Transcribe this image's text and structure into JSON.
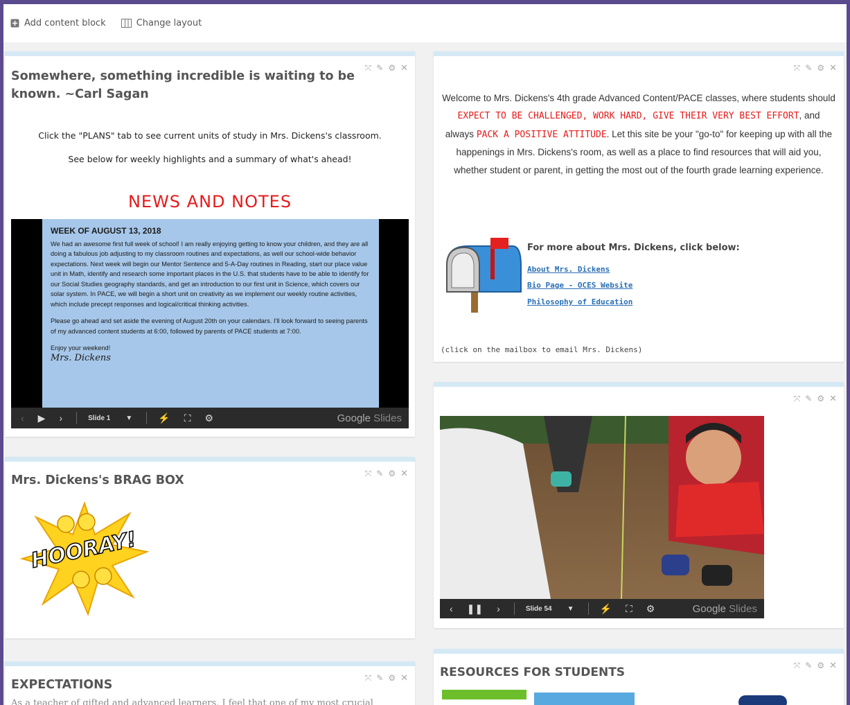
{
  "toolbar": {
    "add_label": "Add content block",
    "layout_label": "Change layout"
  },
  "quote_block": {
    "title": "Somewhere, something incredible is waiting to be known. ~Carl Sagan",
    "note1": "Click the \"PLANS\" tab to see current units of study in Mrs. Dickens's classroom.",
    "note2": "See below for weekly highlights and a summary of what's ahead!",
    "news_heading": "NEWS AND NOTES",
    "slide": {
      "heading": "WEEK OF AUGUST 13, 2018",
      "para1": "We had an awesome first full week of school! I am really enjoying getting to know your children, and they are all doing a fabulous job adjusting to my classroom routines and expectations, as well our school-wide behavior expectations. Next week will begin our Mentor Sentence and 5-A-Day routines in Reading, start our place value unit in Math, identify and research some important places in the U.S. that students have to be able to identify for our Social Studies geography standards, and get an introduction to our first unit in Science, which covers our solar system. In PACE, we will begin a short unit on creativity as we implement our weekly routine activities, which include precept responses and logical/critical thinking activities.",
      "para2": "Please go ahead and set aside the evening of August 20th on your calendars. I'll look forward to seeing parents of my advanced content students at 6:00, followed by parents of PACE students at 7:00.",
      "closing": "Enjoy your weekend!",
      "signature": "Mrs. Dickens"
    },
    "player": {
      "slide_label": "Slide 1",
      "brand_google": "Google",
      "brand_slides": "Slides"
    }
  },
  "brag_block": {
    "title": "Mrs. Dickens's BRAG BOX",
    "hooray": "HOORAY!"
  },
  "expectations_block": {
    "title": "EXPECTATIONS",
    "peek_text": "As a teacher of gifted and advanced learners, I feel that one of my most crucial"
  },
  "welcome_block": {
    "text1": "Welcome to Mrs. Dickens's 4th grade Advanced Content/PACE classes, where students should ",
    "red1": "EXPECT TO BE CHALLENGED, WORK HARD, GIVE THEIR VERY BEST EFFORT",
    "text2": ", and always ",
    "red2": "PACK A POSITIVE ATTITUDE",
    "text3": ". Let this site be your \"go-to\" for keeping up with all the happenings in Mrs. Dickens's room, as well as a place to find resources that will aid you, whether student or parent, in getting the most out of the fourth grade learning experience.",
    "more_title": "For more about Mrs. Dickens, click below:",
    "links": [
      "About Mrs. Dickens",
      "Bio Page - OCES Website",
      "Philosophy of Education"
    ],
    "click_note": "(click on the mailbox to email Mrs. Dickens)"
  },
  "photo_block": {
    "player": {
      "slide_label": "Slide 54",
      "brand_google": "Google",
      "brand_slides": "Slides"
    }
  },
  "resources_block": {
    "title": "RESOURCES FOR STUDENTS"
  },
  "colors": {
    "accent_red": "#e51b1b",
    "block_top_border": "#d5e9f5",
    "link": "#2a6fb5",
    "outer_bg": "#5c4a8e"
  }
}
